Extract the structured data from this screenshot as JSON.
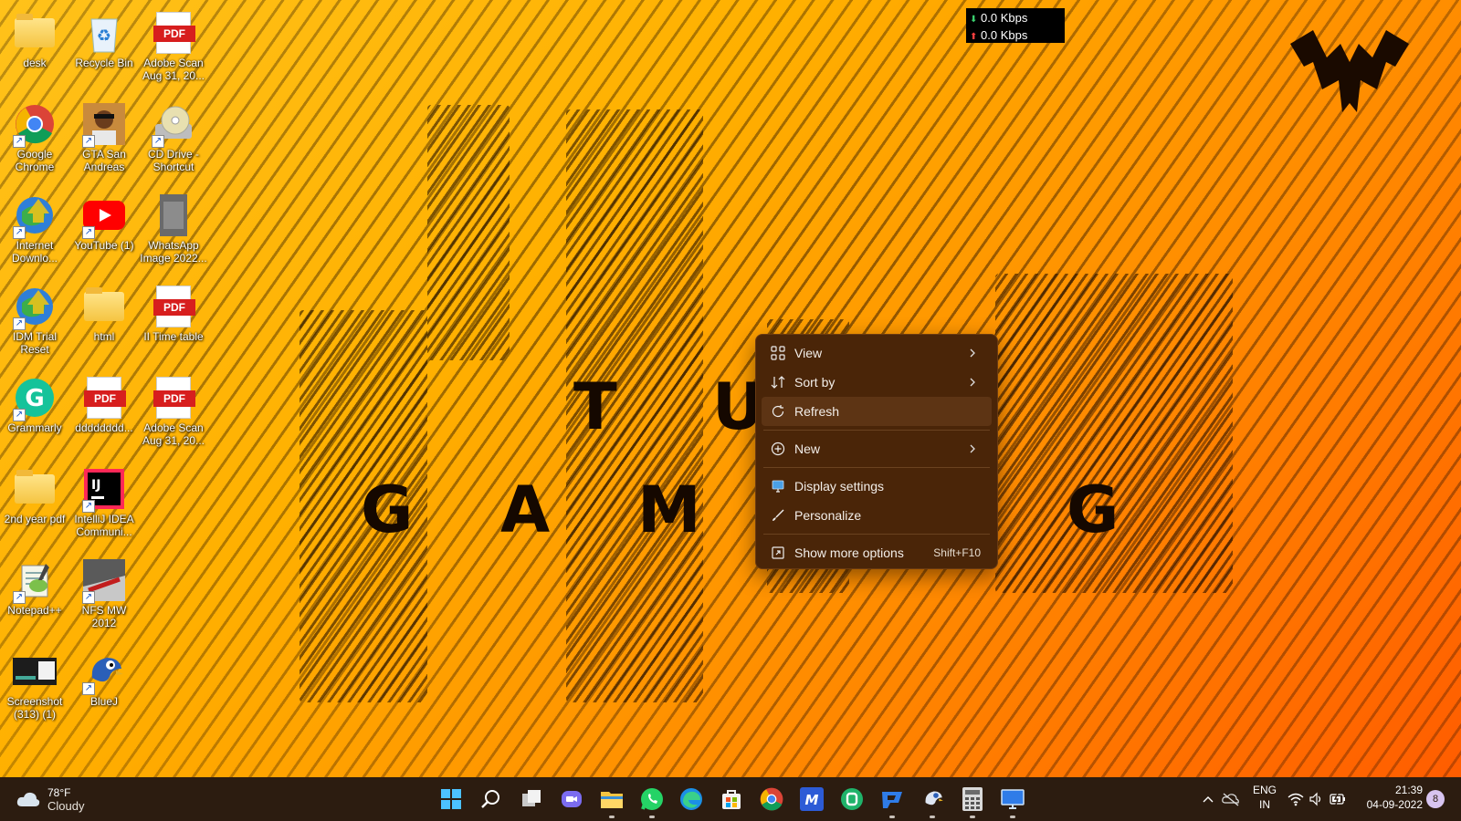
{
  "desktop_icons": [
    {
      "label": "desk"
    },
    {
      "label": "Recycle Bin"
    },
    {
      "label": "Adobe Scan Aug 31, 20..."
    },
    {
      "label": "Google Chrome"
    },
    {
      "label": "GTA San Andreas"
    },
    {
      "label": "CD Drive - Shortcut"
    },
    {
      "label": "Internet Downlo..."
    },
    {
      "label": "YouTube (1)"
    },
    {
      "label": "WhatsApp Image 2022..."
    },
    {
      "label": "IDM Trial Reset"
    },
    {
      "label": "html"
    },
    {
      "label": "II Time table"
    },
    {
      "label": "Grammarly"
    },
    {
      "label": "dddddddd..."
    },
    {
      "label": "Adobe Scan Aug 31, 20..."
    },
    {
      "label": "2nd year pdf"
    },
    {
      "label": "IntelliJ IDEA Communi..."
    },
    {
      "label": "Notepad++"
    },
    {
      "label": "NFS MW 2012"
    },
    {
      "label": "Screenshot (313) (1)"
    },
    {
      "label": "BlueJ"
    }
  ],
  "pdf_badge": "PDF",
  "wallpaper_letters": {
    "row1": [
      "T",
      "U"
    ],
    "row2": [
      "G",
      "A",
      "M",
      "G"
    ]
  },
  "netspeed": {
    "down": "0.0 Kbps",
    "up": "0.0 Kbps",
    "down_arrow": "⬇",
    "up_arrow": "⬆"
  },
  "context_menu": {
    "items": [
      {
        "label": "View",
        "icon": "grid-icon",
        "submenu": true
      },
      {
        "label": "Sort by",
        "icon": "sort-icon",
        "submenu": true
      },
      {
        "label": "Refresh",
        "icon": "refresh-icon",
        "submenu": false
      },
      {
        "label": "New",
        "icon": "plus-circle-icon",
        "submenu": true
      },
      {
        "label": "Display settings",
        "icon": "display-icon",
        "submenu": false
      },
      {
        "label": "Personalize",
        "icon": "brush-icon",
        "submenu": false
      },
      {
        "label": "Show more options",
        "icon": "more-options-icon",
        "submenu": false,
        "shortcut": "Shift+F10"
      }
    ]
  },
  "taskbar": {
    "weather": {
      "temp": "78°F",
      "condition": "Cloudy"
    },
    "apps": [
      "start",
      "search",
      "task-view",
      "chat",
      "file-explorer",
      "whatsapp",
      "edge",
      "store",
      "chrome",
      "app-m",
      "app-green",
      "app-blue",
      "bluej",
      "calculator",
      "display-app"
    ],
    "language": {
      "top": "ENG",
      "bottom": "IN"
    },
    "time": "21:39",
    "date": "04-09-2022",
    "notifications": "8"
  },
  "colors": {
    "menu_bg": "#4a2508",
    "taskbar_bg": "#2c1c10",
    "accent": "#ff8c00"
  }
}
